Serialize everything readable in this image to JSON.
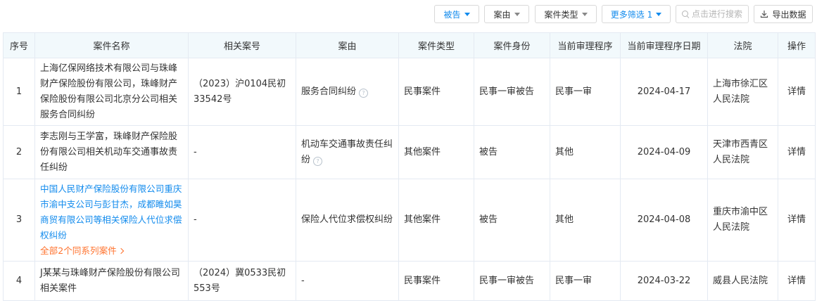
{
  "toolbar": {
    "defendant_filter": "被告",
    "cause_filter": "案由",
    "case_type_filter": "案件类型",
    "more_filters": "更多筛选 1",
    "search_placeholder": "点击进行搜索",
    "export": "导出数据"
  },
  "table": {
    "headers": [
      "序号",
      "案件名称",
      "相关案号",
      "案由",
      "案件类型",
      "案件身份",
      "当前审理程序",
      "当前审理程序日期",
      "法院",
      "操作"
    ],
    "rows": [
      {
        "index": "1",
        "name": "上海亿保网络技术有限公司与珠峰财产保险股份有限公司，珠峰财产保险股份有限公司北京分公司相关服务合同纠纷",
        "case_no": "（2023）沪0104民初33542号",
        "cause": "服务合同纠纷",
        "type": "民事案件",
        "role": "民事一审被告",
        "stage": "民事一审",
        "date": "2024-04-17",
        "court": "上海市徐汇区人民法院",
        "action": "详情"
      },
      {
        "index": "2",
        "name": "李志刚与王学富，珠峰财产保险股份有限公司相关机动车交通事故责任纠纷",
        "case_no": "-",
        "cause": "机动车交通事故责任纠纷",
        "type": "其他案件",
        "role": "被告",
        "stage": "其他",
        "date": "2024-04-09",
        "court": "天津市西青区人民法院",
        "action": "详情"
      },
      {
        "index": "3",
        "name": "中国人民财产保险股份有限公司重庆市渝中支公司与彭甘杰，成都睢如昊商贸有限公司等相关保险人代位求偿权纠纷",
        "series_link": "全部2个同系列案件",
        "case_no": "-",
        "cause": "保险人代位求偿权纠纷",
        "type": "其他案件",
        "role": "被告",
        "stage": "其他",
        "date": "2024-04-08",
        "court": "重庆市渝中区人民法院",
        "action": "详情"
      },
      {
        "index": "4",
        "name": "J某某与珠峰财产保险股份有限公司相关案件",
        "case_no": "（2024）冀0533民初553号",
        "cause": "-",
        "type": "民事案件",
        "role": "民事一审被告",
        "stage": "民事一审",
        "date": "2024-03-22",
        "court": "威县人民法院",
        "action": "详情"
      }
    ]
  }
}
